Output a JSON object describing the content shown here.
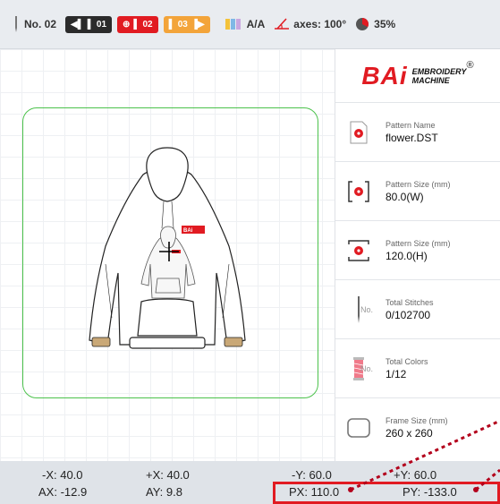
{
  "topbar": {
    "machine_no": "No. 02",
    "needle_prev": "01",
    "needle_current": "02",
    "needle_next": "03",
    "thread_mode": "A/A",
    "axes_label": "axes: 100°",
    "progress": "35%",
    "progress_value": 0.35,
    "colors": {
      "dark": "#2b2b2b",
      "red": "#e11b22",
      "orange": "#f3a43a"
    }
  },
  "logo": {
    "brand": "BAi",
    "line1": "EMBROIDERY",
    "line2": "MACHINE",
    "mark": "®"
  },
  "info_panel": [
    {
      "label": "Pattern Name",
      "value": "flower.DST",
      "icon": "pattern-file-icon"
    },
    {
      "label": "Pattern Size (mm)",
      "value": "80.0(W)",
      "icon": "pattern-width-icon"
    },
    {
      "label": "Pattern Size (mm)",
      "value": "120.0(H)",
      "icon": "pattern-height-icon"
    },
    {
      "label": "Total Stitches",
      "value": "0/102700",
      "icon": "needle-icon",
      "icon_text": "No."
    },
    {
      "label": "Total Colors",
      "value": "1/12",
      "icon": "thread-spool-icon",
      "icon_text": "No."
    },
    {
      "label": "Frame Size (mm)",
      "value": "260 x 260",
      "icon": "frame-icon"
    }
  ],
  "status": {
    "minus_x": "-X: 40.0",
    "plus_x": "+X: 40.0",
    "minus_y": "-Y: 60.0",
    "plus_y": "+Y: 60.0",
    "ax": "AX: -12.9",
    "ay": "AY: 9.8",
    "px": "PX: 110.0",
    "py": "PY: -133.0"
  },
  "hoodie_patch": "BAi"
}
